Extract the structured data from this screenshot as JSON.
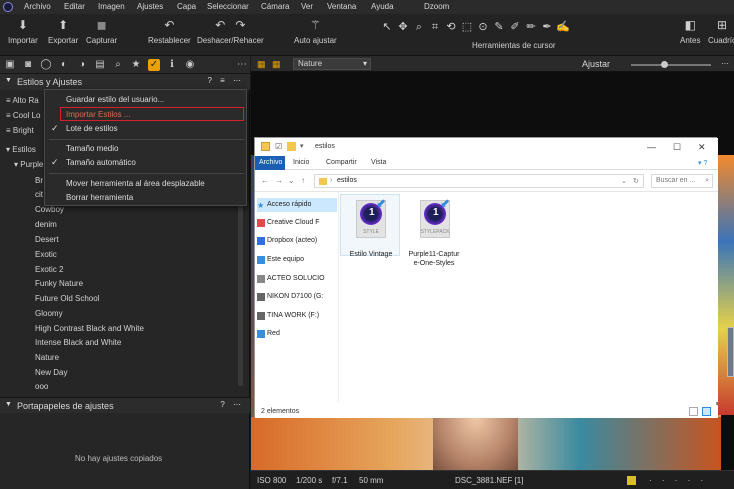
{
  "menubar": {
    "items": [
      "Archivo",
      "Editar",
      "Imagen",
      "Ajustes",
      "Capa",
      "Seleccionar",
      "Cámara",
      "Ver",
      "Ventana",
      "Ayuda"
    ],
    "window_title": "Dzoom"
  },
  "toolbar": {
    "importar": "Importar",
    "exportar": "Exportar",
    "capturar": "Capturar",
    "restablecer": "Restablecer",
    "deshacer": "Deshacer/Rehacer",
    "auto_ajustar": "Auto ajustar",
    "cursor_tools": "Herramientas de cursor",
    "antes": "Antes",
    "cuadricula": "Cuadríc"
  },
  "left_panel": {
    "section_title": "Estilos y Ajustes",
    "rows": [
      "Alto Ra",
      "Cool Lo",
      "Bright",
      "Estilos",
      "Purple"
    ],
    "partial_items": [
      "Br",
      "cit"
    ],
    "styles": [
      "Cowboy",
      "denim",
      "Desert",
      "Exotic",
      "Exotic 2",
      "Funky Nature",
      "Future Old School",
      "Gloomy",
      "High Contrast Black and White",
      "Intense Black and White",
      "Nature",
      "New Day",
      "ooo"
    ],
    "portapapeles_title": "Portapapeles de ajustes",
    "empty_text": "No hay ajustes copiados"
  },
  "context_menu": {
    "save_user_style": "Guardar estilo del usuario...",
    "import_styles": "Importar Estilos ...",
    "style_batch": "Lote de estilos",
    "medium_size": "Tamaño medio",
    "auto_size": "Tamaño automático",
    "move_tool": "Mover herramienta al área desplazable",
    "delete_tool": "Borrar herramienta"
  },
  "viewer": {
    "select_value": "Nature",
    "adjust_label": "Ajustar"
  },
  "statusbar": {
    "iso": "ISO 800",
    "shutter": "1/200 s",
    "aperture": "f/7.1",
    "focal": "50 mm",
    "filename": "DSC_3881.NEF [1]"
  },
  "explorer": {
    "title": "estilos",
    "tabs": [
      "Archivo",
      "Inicio",
      "Compartir",
      "Vista"
    ],
    "path": "estilos",
    "search_placeholder": "Buscar en ...",
    "nav": [
      "Acceso rápido",
      "Creative Cloud F",
      "Dropbox (acteo)",
      "Este equipo",
      "ACTEO SOLUCIO",
      "NIKON D7100 (G:",
      "TINA WORK (F:)",
      "Red"
    ],
    "files": [
      {
        "name": "Estilo Vintage",
        "tag": "STYLE"
      },
      {
        "name": "Purple11-Capture-One-Styles",
        "name_l1": "Purple11-Captur",
        "name_l2": "e-One-Styles",
        "tag": "STYLEPACK"
      }
    ],
    "status": "2 elementos"
  },
  "colors": {
    "accent": "#e9a100",
    "highlight_border": "#d4222a",
    "explorer_blue": "#1a5fb4"
  }
}
